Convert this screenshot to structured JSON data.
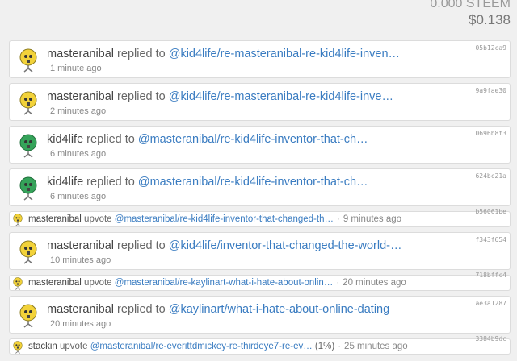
{
  "balance": {
    "steem": "0.000 STEEM",
    "usd": "$0.138"
  },
  "icons": {
    "yellow": "#f2d23a",
    "green": "#35a35a"
  },
  "feed": [
    {
      "kind": "reply",
      "icon": "yellow-robot-avatar",
      "user": "masteranibal",
      "action": "replied to",
      "link": "@kid4life/re-masteranibal-re-kid4life-inven…",
      "time": "1 minute ago",
      "hash": "05b12ca9"
    },
    {
      "kind": "reply",
      "icon": "yellow-robot-avatar",
      "user": "masteranibal",
      "action": "replied to",
      "link": "@kid4life/re-masteranibal-re-kid4life-inve…",
      "time": "2 minutes ago",
      "hash": "9a9fae30"
    },
    {
      "kind": "reply",
      "icon": "green-robot-avatar",
      "user": "kid4life",
      "action": "replied to",
      "link": "@masteranibal/re-kid4life-inventor-that-ch…",
      "time": "6 minutes ago",
      "hash": "0696b8f3"
    },
    {
      "kind": "reply",
      "icon": "green-robot-avatar",
      "user": "kid4life",
      "action": "replied to",
      "link": "@masteranibal/re-kid4life-inventor-that-ch…",
      "time": "6 minutes ago",
      "hash": "624bc21a"
    },
    {
      "kind": "vote",
      "icon": "yellow-robot-avatar",
      "user": "masteranibal",
      "action": "upvote",
      "link": "@masteranibal/re-kid4life-inventor-that-changed-th…",
      "extra": "",
      "time": "9 minutes ago",
      "hash": "b56061be"
    },
    {
      "kind": "reply",
      "icon": "yellow-robot-avatar",
      "user": "masteranibal",
      "action": "replied to",
      "link": "@kid4life/inventor-that-changed-the-world-…",
      "time": "10 minutes ago",
      "hash": "f343f654"
    },
    {
      "kind": "vote",
      "icon": "yellow-robot-avatar",
      "user": "masteranibal",
      "action": "upvote",
      "link": "@masteranibal/re-kaylinart-what-i-hate-about-onlin…",
      "extra": "",
      "time": "20 minutes ago",
      "hash": "718bffc4"
    },
    {
      "kind": "reply",
      "icon": "yellow-robot-avatar",
      "user": "masteranibal",
      "action": "replied to",
      "link": "@kaylinart/what-i-hate-about-online-dating",
      "time": "20 minutes ago",
      "hash": "ae3a1287"
    },
    {
      "kind": "vote",
      "icon": "yellow-robot-avatar",
      "user": "stackin",
      "action": "upvote",
      "link": "@masteranibal/re-everittdmickey-re-thirdeye7-re-ev…",
      "extra": "(1%)",
      "time": "25 minutes ago",
      "hash": "3384b9dc"
    }
  ]
}
